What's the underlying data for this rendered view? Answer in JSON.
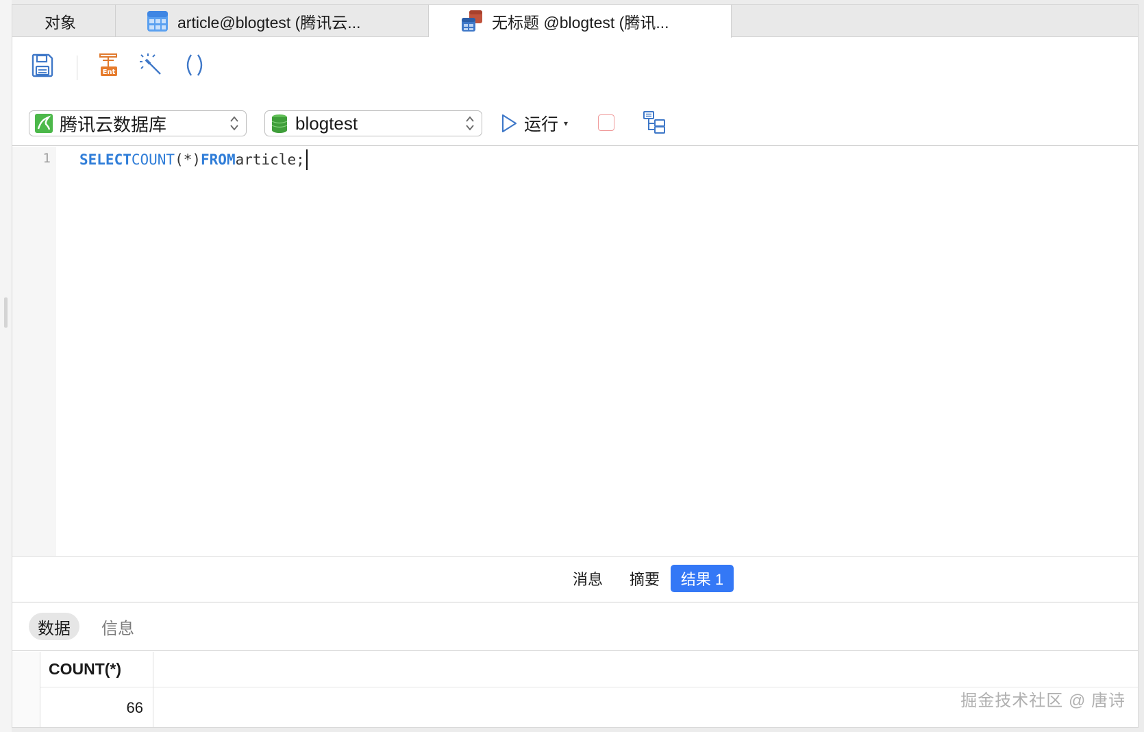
{
  "tabs": [
    {
      "label": "对象",
      "icon": "none"
    },
    {
      "label": "article@blogtest (腾讯云...",
      "icon": "table-icon"
    },
    {
      "label": "无标题 @blogtest (腾讯...",
      "icon": "query-icon",
      "active": true
    }
  ],
  "toolbar": {
    "save": "save-icon",
    "format": "text-format-icon",
    "beautify": "magic-wand-icon",
    "parens": "parentheses-icon"
  },
  "selectors": {
    "connection": "腾讯云数据库",
    "database": "blogtest"
  },
  "run": {
    "label": "运行",
    "caret": "▾"
  },
  "editor": {
    "line_number": "1",
    "tokens": {
      "kw_select": "SELECT",
      "fn_count": "COUNT",
      "args": "(*)",
      "kw_from": "FROM",
      "rest": "article;"
    }
  },
  "result_tabs": {
    "messages": "消息",
    "summary": "摘要",
    "result": "结果 1"
  },
  "sub_tabs": {
    "data": "数据",
    "info": "信息"
  },
  "grid": {
    "columns": [
      "COUNT(*)"
    ],
    "rows": [
      [
        "66"
      ]
    ]
  },
  "watermark": "掘金技术社区 @ 唐诗",
  "colors": {
    "accent": "#3478f6",
    "keyword": "#2f7dd8",
    "stop": "#f09a9a"
  }
}
